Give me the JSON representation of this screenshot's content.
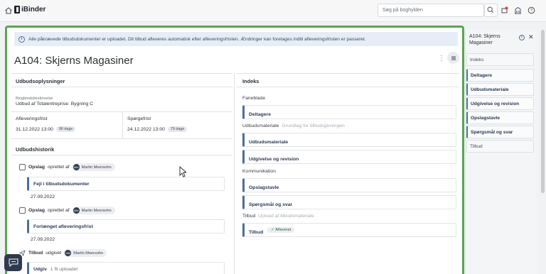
{
  "app": {
    "brand": "iBinder"
  },
  "search": {
    "placeholder": "Søg på boghylden"
  },
  "banner": {
    "text": "Alle påkrævede tilbudsdokumenter er uploadet. Dit tilbud afleveres automatisk efter afleveringsfristen. Ændringer kan foretages indtil afleveringsfristen er passeret."
  },
  "page": {
    "title": "A104: Skjerns Magasiner"
  },
  "details": {
    "heading": "Udbudsoplysninger",
    "desc_label": "Bingbindsbeskrivelse",
    "desc_value": "Udbud af Totalentreprise: Bygning C",
    "deadline_label": "Afleveringsfrist",
    "deadline_value": "31.12.2022 13:00",
    "deadline_days": "96 dage",
    "question_label": "Spørgefrist",
    "question_value": "24.12.2022 13:00",
    "question_days": "79 dage"
  },
  "history": {
    "heading": "Udbudshistorik",
    "entries": [
      {
        "action": "Opslag",
        "suffix": "oprettet af",
        "user": "Martin Meersohn",
        "initials": "MM",
        "card": "Fejl i tilbudsdokumenter",
        "date": "27.09.2022"
      },
      {
        "action": "Opslag",
        "suffix": "oprettet af",
        "user": "Martin Meersohn",
        "initials": "MM",
        "card": "Forlænget afleveringsfrist",
        "date": "27.09.2022"
      },
      {
        "action": "Tilbud",
        "suffix": "udgivet",
        "user": "Martin Meersohn",
        "initials": "MM",
        "card": "Udgiv",
        "card_sub": "1 fil uploadet"
      }
    ]
  },
  "index": {
    "heading": "Indeks",
    "groups": [
      {
        "label": "Faneblade",
        "sub": "",
        "cards": [
          "Deltagere"
        ]
      },
      {
        "label": "Udbudsmateriale",
        "sub": "Grundlag for tilbudsgivningen",
        "cards": [
          "Udbudsmateriale",
          "Udgivelse og revision"
        ]
      },
      {
        "label": "Kommunikation",
        "sub": "",
        "cards": [
          "Opslagstavle",
          "Spørgsmål og svar"
        ]
      },
      {
        "label": "Tilbud",
        "sub": "Upload af tilbudsmateriale",
        "cards": [
          "Tilbud"
        ]
      }
    ],
    "tilbud_badge": "Afleveret"
  },
  "sidepanel": {
    "title": "A104: Skjerns Magasiner",
    "items": [
      "Indeks",
      "Deltagere",
      "Udbudsmateriale",
      "Udgivelse og revision",
      "Opslagstavle",
      "Spørgsmål og svar",
      "Tilbud"
    ]
  },
  "colors": {
    "frame_accent": "#5aa552",
    "card_accent": "#4c6e9c",
    "banner_bg": "#e6edf6"
  }
}
